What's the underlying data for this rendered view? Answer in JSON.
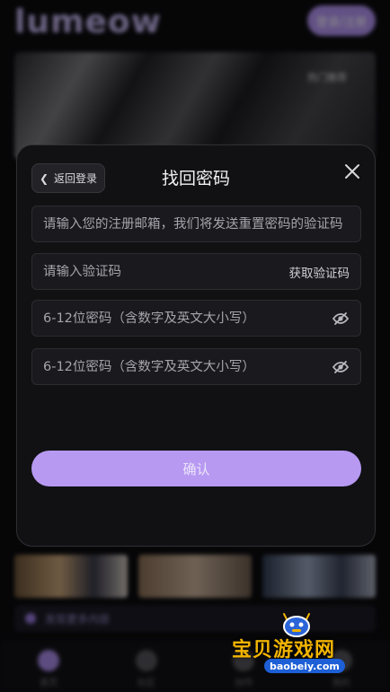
{
  "background": {
    "logo": "lumeow",
    "login_button": "登录/注册",
    "banner_tag": "热门推荐",
    "strip_text": "发现更多内容",
    "tabs": [
      "首页",
      "社区",
      "创作",
      "我的"
    ]
  },
  "modal": {
    "back_label": "返回登录",
    "title": "找回密码",
    "email_placeholder": "请输入您的注册邮箱，我们将发送重置密码的验证码",
    "code_placeholder": "请输入验证码",
    "get_code_label": "获取验证码",
    "password_placeholder": "6-12位密码（含数字及英文大小写）",
    "confirm_password_placeholder": "6-12位密码（含数字及英文大小写）",
    "confirm_label": "确认"
  },
  "watermark": {
    "title": "宝贝游戏网",
    "url": "baobeiy.com"
  },
  "colors": {
    "accent": "#b799f2",
    "modal_bg": "#111114",
    "field_bg": "#1a1a1e"
  },
  "icons": {
    "back": "chevron-left-icon",
    "close": "close-icon",
    "password_toggle": "eye-off-icon"
  }
}
